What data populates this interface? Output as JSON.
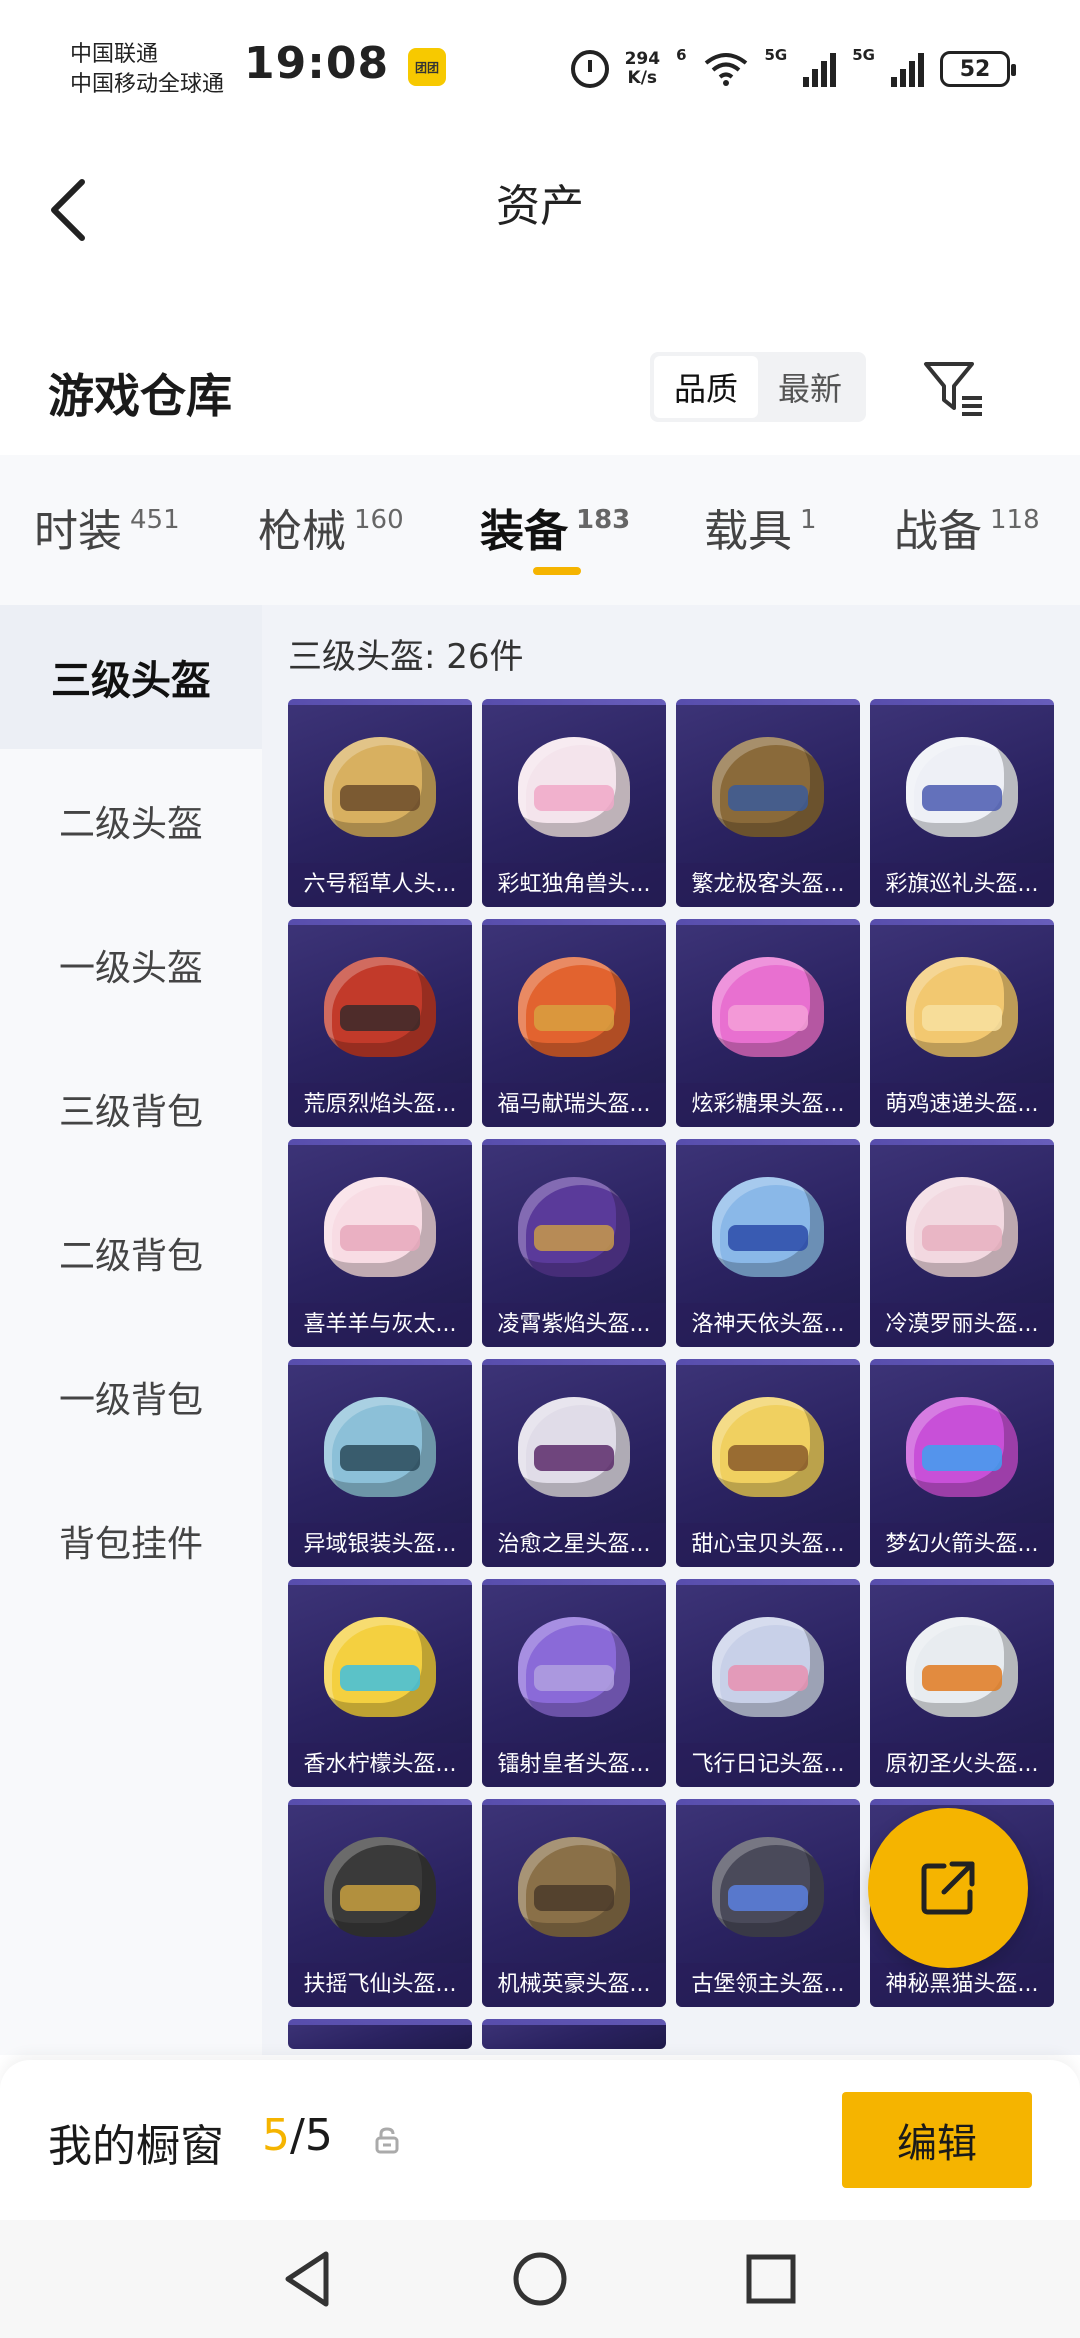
{
  "status": {
    "carrier1": "中国联通",
    "carrier2": "中国移动全球通",
    "time": "19:08",
    "mini_app_icon": "团团",
    "net_speed_top": "294",
    "net_speed_unit": "K/s",
    "wifi_label": "6",
    "sim1_label": "5G",
    "sim2_label": "5G",
    "battery": "52"
  },
  "header": {
    "title": "资产"
  },
  "warehouse": {
    "title": "游戏仓库",
    "sort_quality": "品质",
    "sort_newest": "最新"
  },
  "tabs": [
    {
      "label": "时装",
      "count": "451"
    },
    {
      "label": "枪械",
      "count": "160"
    },
    {
      "label": "装备",
      "count": "183"
    },
    {
      "label": "载具",
      "count": "1"
    },
    {
      "label": "战备",
      "count": "118"
    }
  ],
  "sidebar": [
    {
      "label": "三级头盔"
    },
    {
      "label": "二级头盔"
    },
    {
      "label": "一级头盔"
    },
    {
      "label": "三级背包"
    },
    {
      "label": "二级背包"
    },
    {
      "label": "一级背包"
    },
    {
      "label": "背包挂件"
    }
  ],
  "grid": {
    "title": "三级头盔: 26件",
    "items": [
      {
        "label": "六号稻草人头...",
        "color": "#d8b060",
        "visor": "#6b4b2a"
      },
      {
        "label": "彩虹独角兽头...",
        "color": "#f4e4ec",
        "visor": "#f0a8c8"
      },
      {
        "label": "繁龙极客头盔...",
        "color": "#8a6a3a",
        "visor": "#3a5a9a"
      },
      {
        "label": "彩旗巡礼头盔...",
        "color": "#eef0f6",
        "visor": "#4a5ab0"
      },
      {
        "label": "荒原烈焰头盔...",
        "color": "#c23a2a",
        "visor": "#3a2a2a"
      },
      {
        "label": "福马献瑞头盔...",
        "color": "#e2632f",
        "visor": "#d8a040"
      },
      {
        "label": "炫彩糖果头盔...",
        "color": "#e870d0",
        "visor": "#f4a0d8"
      },
      {
        "label": "萌鸡速递头盔...",
        "color": "#f2c870",
        "visor": "#f8e0a0"
      },
      {
        "label": "喜羊羊与灰太...",
        "color": "#f8dce4",
        "visor": "#e8a8bc"
      },
      {
        "label": "凌霄紫焰头盔...",
        "color": "#5a3a9a",
        "visor": "#c89a4a"
      },
      {
        "label": "洛神天依头盔...",
        "color": "#8ab8e8",
        "visor": "#2a4aa8"
      },
      {
        "label": "冷漠罗丽头盔...",
        "color": "#f2d8e0",
        "visor": "#e8b0c0"
      },
      {
        "label": "异域银装头盔...",
        "color": "#8cc0d8",
        "visor": "#2a4a5a"
      },
      {
        "label": "治愈之星头盔...",
        "color": "#e0dce8",
        "visor": "#5a2a6a"
      },
      {
        "label": "甜心宝贝头盔...",
        "color": "#f0d060",
        "visor": "#8a5a2a"
      },
      {
        "label": "梦幻火箭头盔...",
        "color": "#c850d8",
        "visor": "#40a0f0"
      },
      {
        "label": "香水柠檬头盔...",
        "color": "#f4d040",
        "visor": "#40c0e0"
      },
      {
        "label": "镭射皇者头盔...",
        "color": "#8a6ad8",
        "visor": "#b0a0e0"
      },
      {
        "label": "飞行日记头盔...",
        "color": "#c8d0e8",
        "visor": "#e890b0"
      },
      {
        "label": "原初圣火头盔...",
        "color": "#e8ecf0",
        "visor": "#e07a20"
      },
      {
        "label": "扶摇飞仙头盔...",
        "color": "#3a3a3a",
        "visor": "#c8a040"
      },
      {
        "label": "机械英豪头盔...",
        "color": "#8a7048",
        "visor": "#4a3a2a"
      },
      {
        "label": "古堡领主头盔...",
        "color": "#4a4a5a",
        "visor": "#5a80e0"
      },
      {
        "label": "神秘黑猫头盔...",
        "color": "#2a2a3a",
        "visor": "#6a5aa0"
      }
    ]
  },
  "showcase": {
    "title": "我的橱窗",
    "current": "5",
    "total": "5",
    "edit_label": "编辑"
  },
  "colors": {
    "accent": "#f5b400",
    "card_bg": "#2a2260",
    "sidebar_active_bg": "#eceff5"
  }
}
